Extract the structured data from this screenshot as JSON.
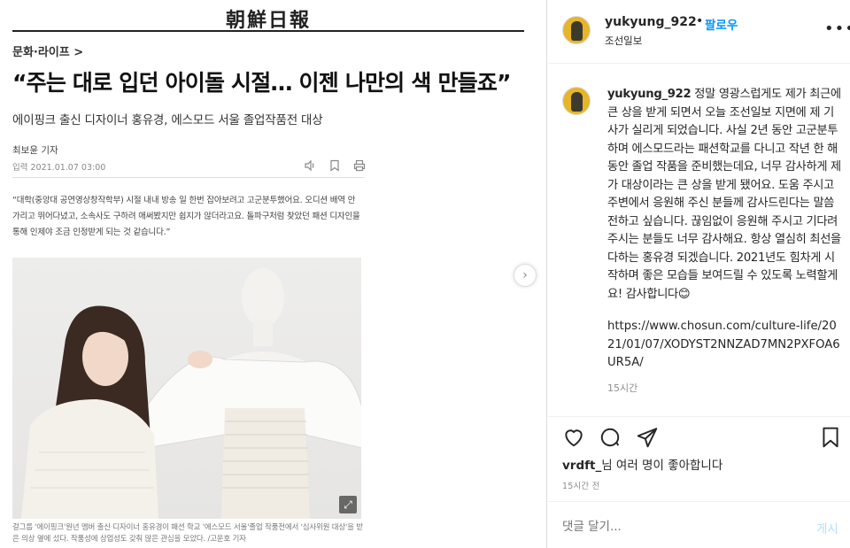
{
  "article": {
    "masthead": "朝鮮日報",
    "section": "문화·라이프 >",
    "headline": "“주는 대로 입던 아이돌 시절… 이젠 나만의 색 만들죠”",
    "subhead": "에이핑크 출신 디자이너 홍유경, 에스모드 서울 졸업작품전 대상",
    "byline": "최보윤 기자",
    "date": "입력 2021.01.07 03:00",
    "quote": "“대학(중앙대 공연영상창작학부) 시절 내내 방송 일 한번 잡아보려고 고군분투했어요. 오디션 배역 안 가리고 뛰어다녔고, 소속사도 구하려 애써봤지만 쉽지가 않더라고요. 돌파구처럼 찾았던 패션 디자인을 통해 인제야 조금 인정받게 되는 것 같습니다.”",
    "photo_caption": "걸그룹 '에이핑크'원년 멤버 출신 디자이너 홍유경이 패션 학교 '에스모드 서울'졸업 작품전에서 '심사위원 대상'을 받은 의상 옆에 섰다. 작품성에 상업성도 갖춰 많은 관심을 모았다. /고운호 기자"
  },
  "header": {
    "username": "yukyung_922",
    "dot": "•",
    "follow_label": "팔로우",
    "location": "조선일보",
    "more_icon": "more-horizontal-icon"
  },
  "post": {
    "username": "yukyung_922",
    "caption": "정말 영광스럽게도 제가 최근에 큰 상을 받게 되면서 오늘 조선일보 지면에 제 기사가 실리게 되었습니다. 사실 2년 동안 고군분투하며 에스모드라는 패션학교를 다니고 작년 한 해 동안 졸업 작품을 준비했는데요, 너무 감사하게 제가 대상이라는 큰 상을 받게 됐어요. 도움 주시고 주변에서 응원해 주신 분들께 감사드린다는 말씀 전하고 싶습니다. 끊임없이 응원해 주시고 기다려주시는 분들도 너무 감사해요. 항상 열심히 최선을 다하는 홍유경 되겠습니다. 2021년도 힘차게 시작하며 좋은 모습들 보여드릴 수 있도록 노력할게요! 감사합니다😊",
    "link": "https://www.chosun.com/culture-life/2021/01/07/XODYST2NNZAD7MN2PXFOA6UR5A/",
    "caption_time": "15시간"
  },
  "engagement": {
    "liker": "vrdft_",
    "likes_suffix": "님 여러 명이 좋아합니다",
    "post_time": "15시간 전"
  },
  "comment": {
    "placeholder": "댓글 달기...",
    "post_label": "게시"
  },
  "colors": {
    "link_blue": "#0095f6",
    "post_disabled": "#b2dffc",
    "muted": "#8e8e8e"
  }
}
